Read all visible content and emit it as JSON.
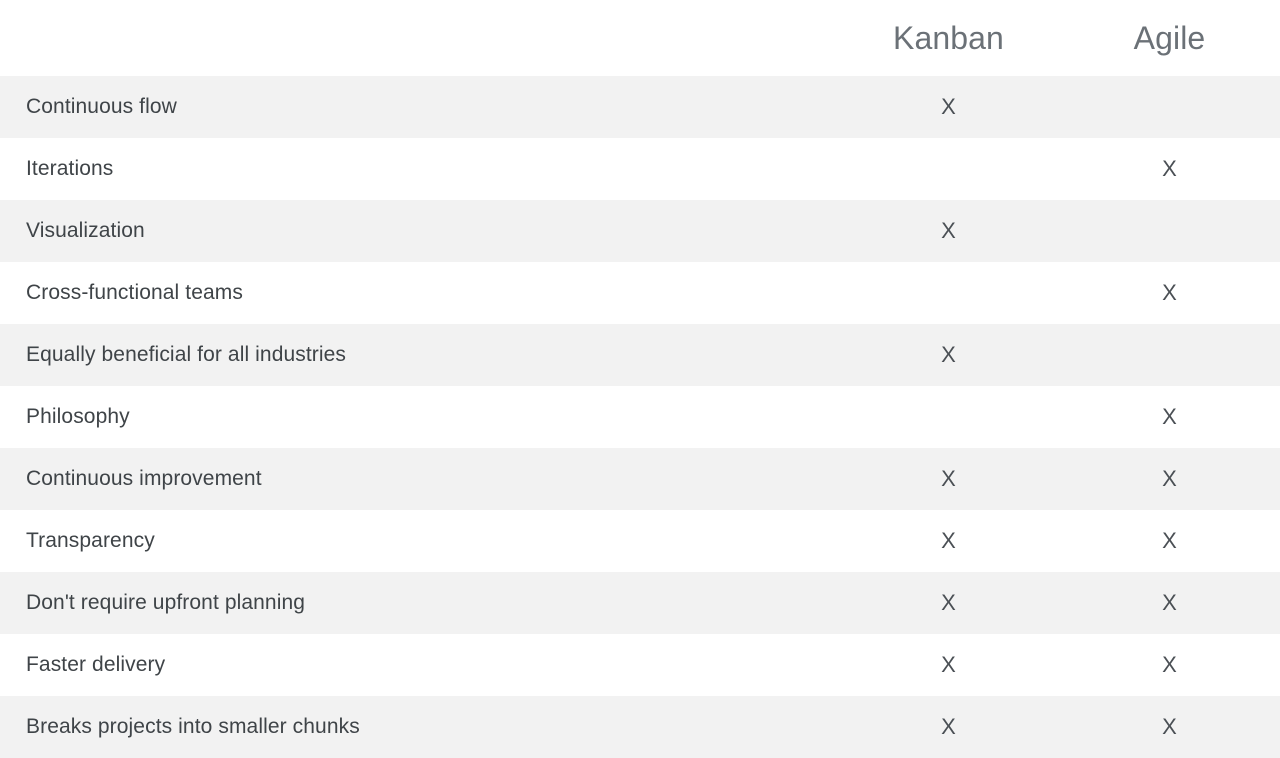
{
  "table": {
    "feature_column_header": "",
    "columns": [
      {
        "key": "kanban",
        "label": "Kanban"
      },
      {
        "key": "agile",
        "label": "Agile"
      }
    ],
    "mark_symbol": "X",
    "colors": {
      "page_background": "#ffffff",
      "stripe_background": "#f2f2f2",
      "header_text": "#6b7177",
      "row_label_text": "#3f4448",
      "mark_text": "#4b5055"
    },
    "rows": [
      {
        "feature": "Continuous flow",
        "kanban": "X",
        "agile": ""
      },
      {
        "feature": "Iterations",
        "kanban": "",
        "agile": "X"
      },
      {
        "feature": "Visualization",
        "kanban": "X",
        "agile": ""
      },
      {
        "feature": "Cross-functional teams",
        "kanban": "",
        "agile": "X"
      },
      {
        "feature": "Equally beneficial for all industries",
        "kanban": "X",
        "agile": ""
      },
      {
        "feature": "Philosophy",
        "kanban": "",
        "agile": "X"
      },
      {
        "feature": "Continuous improvement",
        "kanban": "X",
        "agile": "X"
      },
      {
        "feature": "Transparency",
        "kanban": "X",
        "agile": "X"
      },
      {
        "feature": "Don't require upfront planning",
        "kanban": "X",
        "agile": "X"
      },
      {
        "feature": "Faster delivery",
        "kanban": "X",
        "agile": "X"
      },
      {
        "feature": "Breaks projects into smaller chunks",
        "kanban": "X",
        "agile": "X"
      }
    ]
  },
  "chart_data": {
    "type": "table",
    "title": "",
    "categories": [
      "Continuous flow",
      "Iterations",
      "Visualization",
      "Cross-functional teams",
      "Equally beneficial for all industries",
      "Philosophy",
      "Continuous improvement",
      "Transparency",
      "Don't require upfront planning",
      "Faster delivery",
      "Breaks projects into smaller chunks"
    ],
    "series": [
      {
        "name": "Kanban",
        "values": [
          "X",
          "",
          "X",
          "",
          "X",
          "",
          "X",
          "X",
          "X",
          "X",
          "X"
        ]
      },
      {
        "name": "Agile",
        "values": [
          "",
          "X",
          "",
          "X",
          "",
          "X",
          "X",
          "X",
          "X",
          "X",
          "X"
        ]
      }
    ],
    "xlabel": "",
    "ylabel": "",
    "legend": [
      "Kanban",
      "Agile"
    ],
    "legend_position": "top",
    "grid": false
  }
}
